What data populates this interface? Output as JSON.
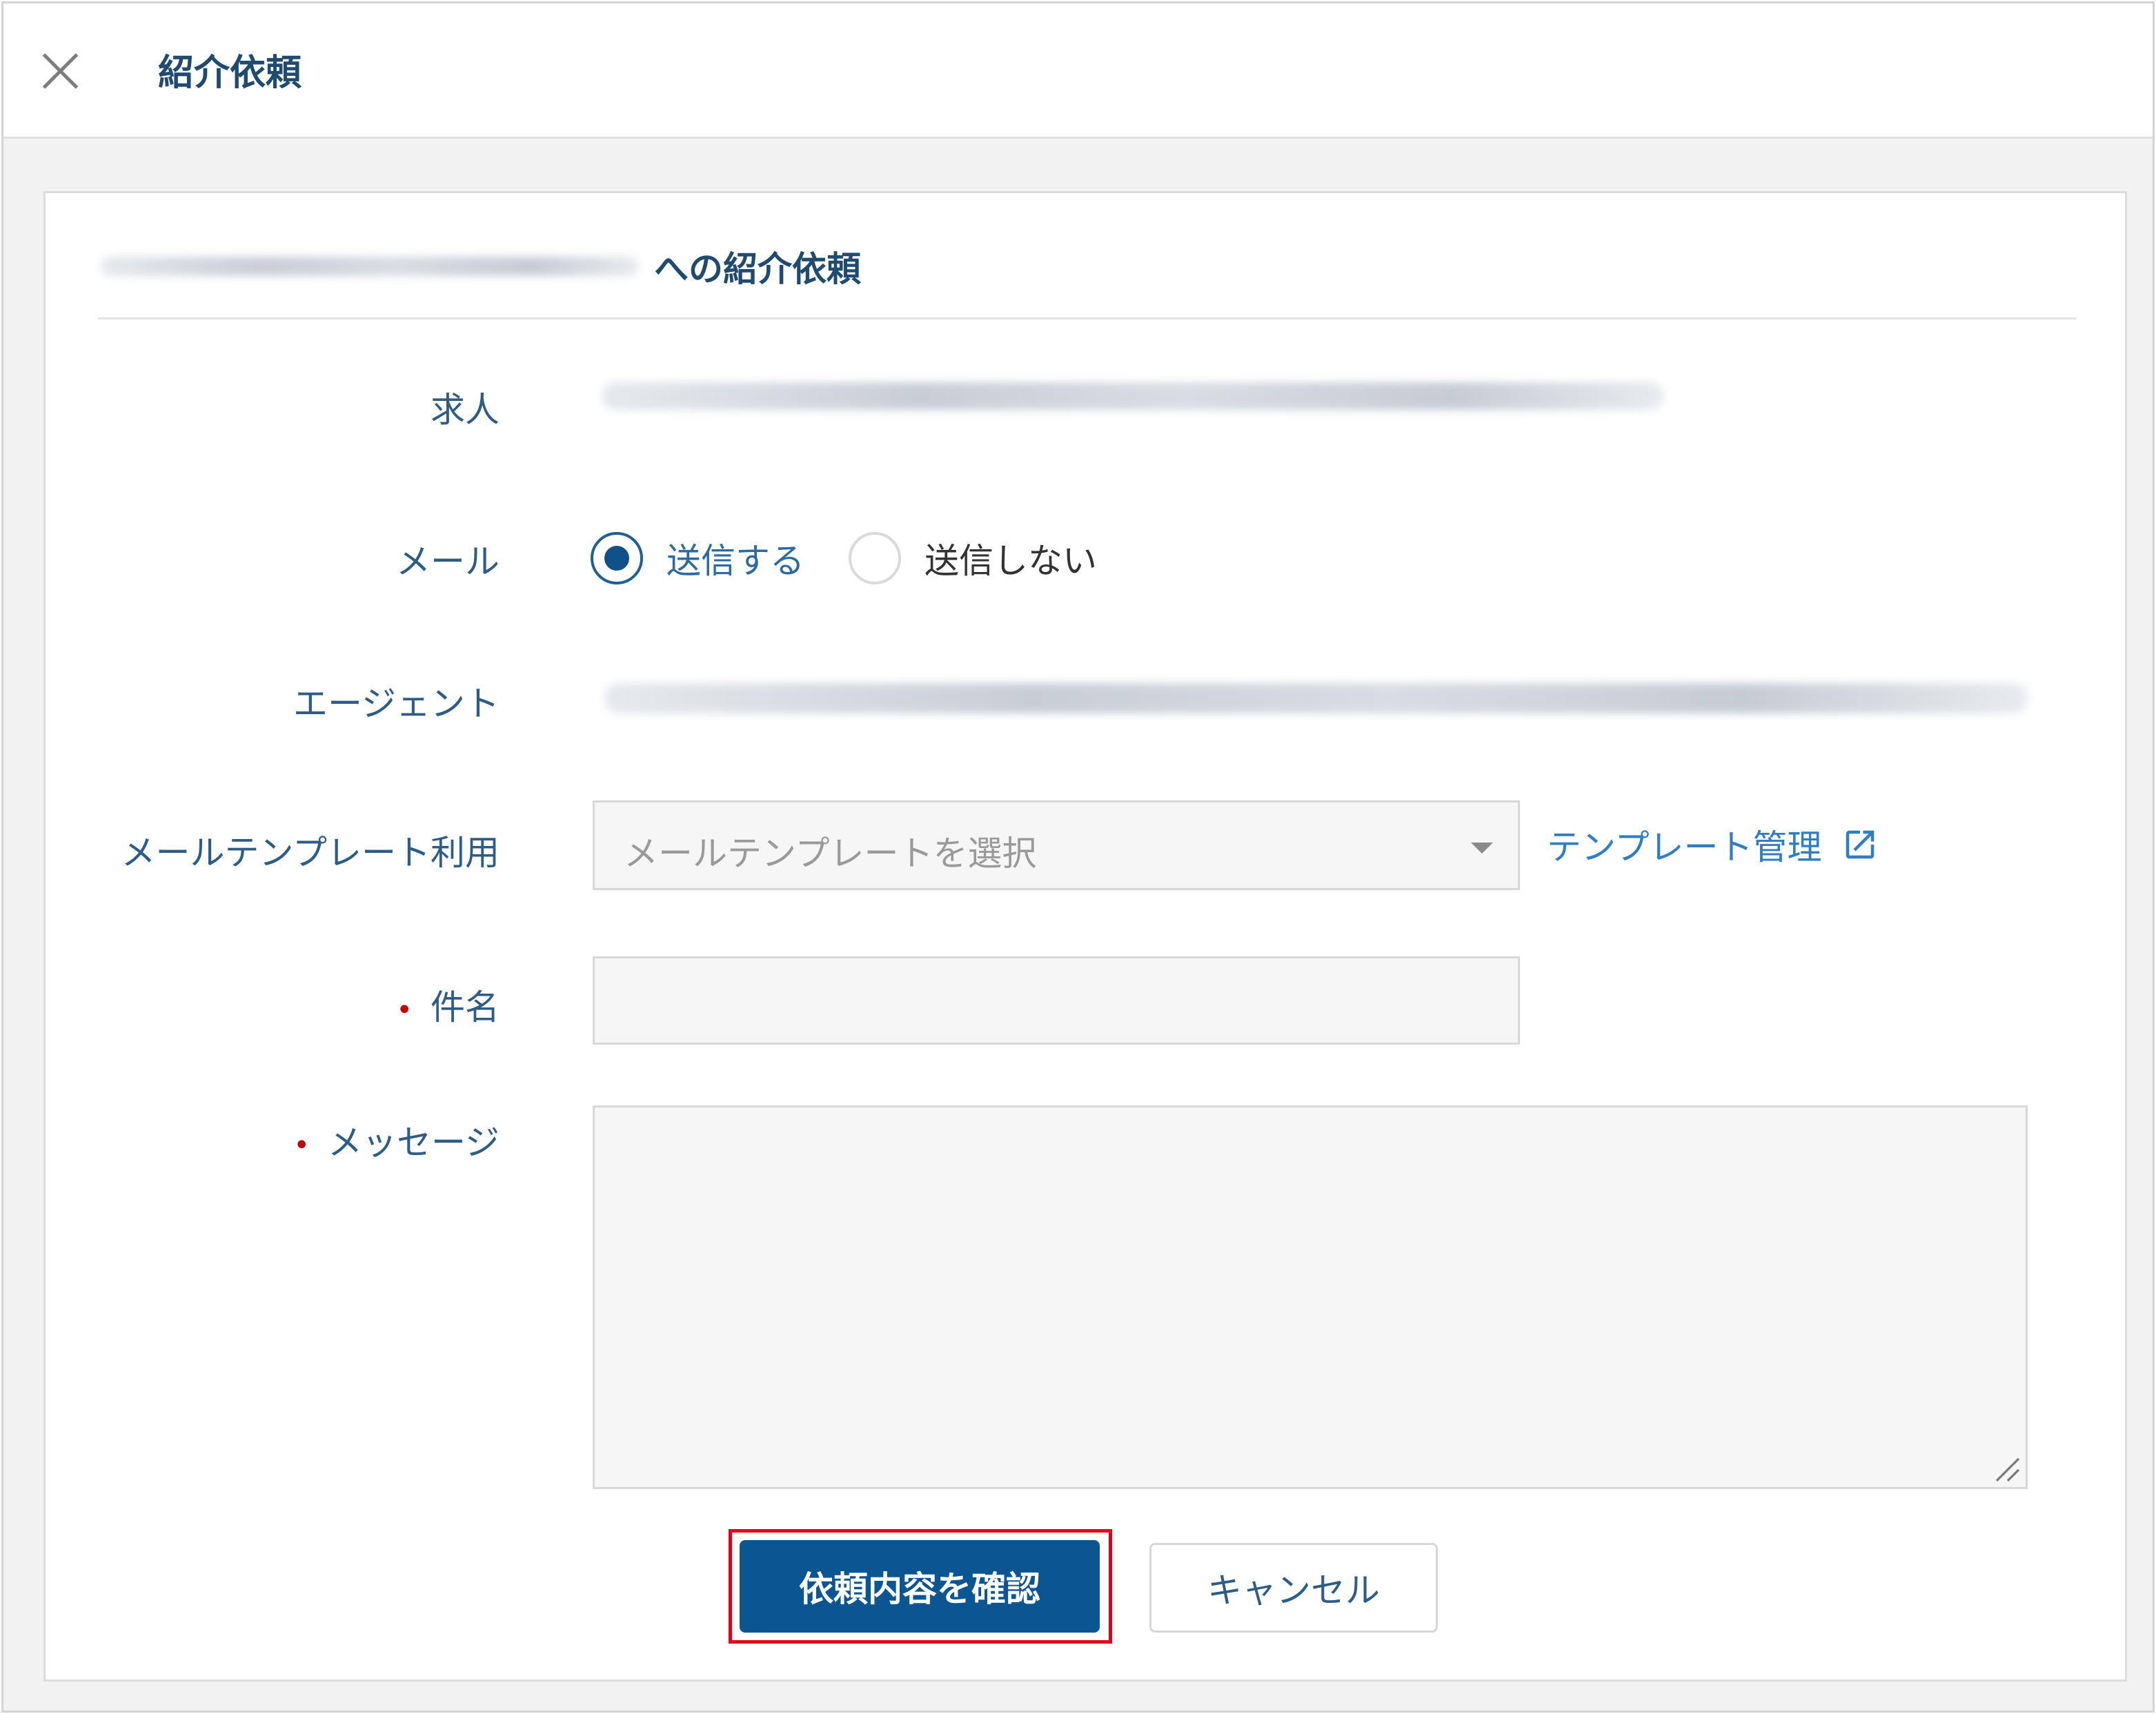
{
  "header": {
    "title": "紹介依頼",
    "close_icon": "close-icon"
  },
  "card": {
    "title_suffix": "への紹介依頼"
  },
  "form": {
    "job_label": "求人",
    "mail_label": "メール",
    "mail_options": {
      "send": "送信する",
      "dont_send": "送信しない",
      "selected": "送信する"
    },
    "agent_label": "エージェント",
    "template_label": "メールテンプレート利用",
    "template_placeholder": "メールテンプレートを選択",
    "template_manage_link": "テンプレート管理",
    "subject_label": "件名",
    "subject_value": "",
    "message_label": "メッセージ",
    "message_value": "",
    "required_mark": "•"
  },
  "actions": {
    "confirm_label": "依頼内容を確認",
    "cancel_label": "キャンセル"
  },
  "colors": {
    "primary": "#0a5592",
    "link": "#2f7ec4",
    "required": "#c40000",
    "highlight": "#e4001a"
  }
}
